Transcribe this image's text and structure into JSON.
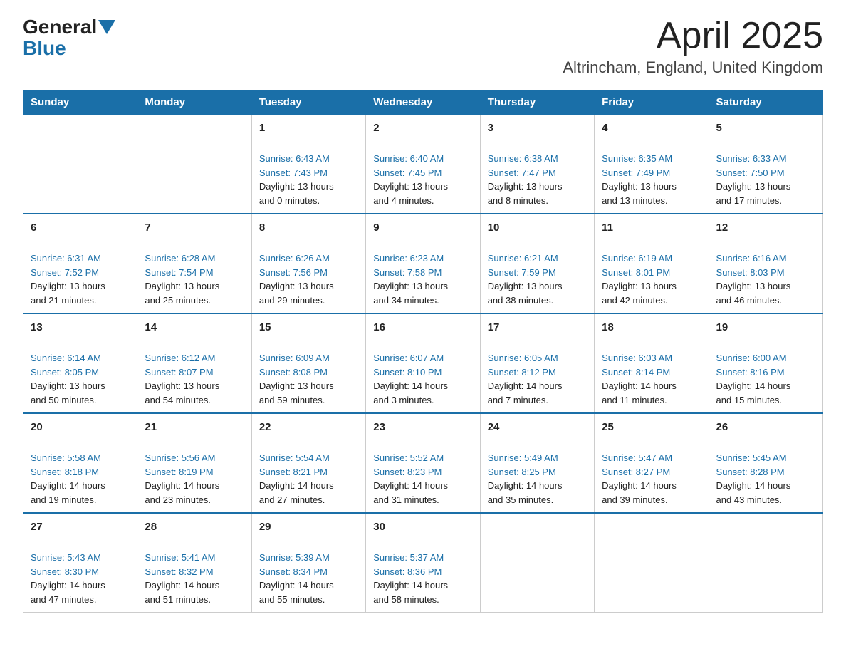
{
  "header": {
    "logo_general": "General",
    "logo_blue": "Blue",
    "month_title": "April 2025",
    "location": "Altrincham, England, United Kingdom"
  },
  "weekdays": [
    "Sunday",
    "Monday",
    "Tuesday",
    "Wednesday",
    "Thursday",
    "Friday",
    "Saturday"
  ],
  "weeks": [
    [
      {
        "day": "",
        "sunrise": "",
        "sunset": "",
        "daylight": ""
      },
      {
        "day": "",
        "sunrise": "",
        "sunset": "",
        "daylight": ""
      },
      {
        "day": "1",
        "sunrise": "Sunrise: 6:43 AM",
        "sunset": "Sunset: 7:43 PM",
        "daylight": "Daylight: 13 hours and 0 minutes."
      },
      {
        "day": "2",
        "sunrise": "Sunrise: 6:40 AM",
        "sunset": "Sunset: 7:45 PM",
        "daylight": "Daylight: 13 hours and 4 minutes."
      },
      {
        "day": "3",
        "sunrise": "Sunrise: 6:38 AM",
        "sunset": "Sunset: 7:47 PM",
        "daylight": "Daylight: 13 hours and 8 minutes."
      },
      {
        "day": "4",
        "sunrise": "Sunrise: 6:35 AM",
        "sunset": "Sunset: 7:49 PM",
        "daylight": "Daylight: 13 hours and 13 minutes."
      },
      {
        "day": "5",
        "sunrise": "Sunrise: 6:33 AM",
        "sunset": "Sunset: 7:50 PM",
        "daylight": "Daylight: 13 hours and 17 minutes."
      }
    ],
    [
      {
        "day": "6",
        "sunrise": "Sunrise: 6:31 AM",
        "sunset": "Sunset: 7:52 PM",
        "daylight": "Daylight: 13 hours and 21 minutes."
      },
      {
        "day": "7",
        "sunrise": "Sunrise: 6:28 AM",
        "sunset": "Sunset: 7:54 PM",
        "daylight": "Daylight: 13 hours and 25 minutes."
      },
      {
        "day": "8",
        "sunrise": "Sunrise: 6:26 AM",
        "sunset": "Sunset: 7:56 PM",
        "daylight": "Daylight: 13 hours and 29 minutes."
      },
      {
        "day": "9",
        "sunrise": "Sunrise: 6:23 AM",
        "sunset": "Sunset: 7:58 PM",
        "daylight": "Daylight: 13 hours and 34 minutes."
      },
      {
        "day": "10",
        "sunrise": "Sunrise: 6:21 AM",
        "sunset": "Sunset: 7:59 PM",
        "daylight": "Daylight: 13 hours and 38 minutes."
      },
      {
        "day": "11",
        "sunrise": "Sunrise: 6:19 AM",
        "sunset": "Sunset: 8:01 PM",
        "daylight": "Daylight: 13 hours and 42 minutes."
      },
      {
        "day": "12",
        "sunrise": "Sunrise: 6:16 AM",
        "sunset": "Sunset: 8:03 PM",
        "daylight": "Daylight: 13 hours and 46 minutes."
      }
    ],
    [
      {
        "day": "13",
        "sunrise": "Sunrise: 6:14 AM",
        "sunset": "Sunset: 8:05 PM",
        "daylight": "Daylight: 13 hours and 50 minutes."
      },
      {
        "day": "14",
        "sunrise": "Sunrise: 6:12 AM",
        "sunset": "Sunset: 8:07 PM",
        "daylight": "Daylight: 13 hours and 54 minutes."
      },
      {
        "day": "15",
        "sunrise": "Sunrise: 6:09 AM",
        "sunset": "Sunset: 8:08 PM",
        "daylight": "Daylight: 13 hours and 59 minutes."
      },
      {
        "day": "16",
        "sunrise": "Sunrise: 6:07 AM",
        "sunset": "Sunset: 8:10 PM",
        "daylight": "Daylight: 14 hours and 3 minutes."
      },
      {
        "day": "17",
        "sunrise": "Sunrise: 6:05 AM",
        "sunset": "Sunset: 8:12 PM",
        "daylight": "Daylight: 14 hours and 7 minutes."
      },
      {
        "day": "18",
        "sunrise": "Sunrise: 6:03 AM",
        "sunset": "Sunset: 8:14 PM",
        "daylight": "Daylight: 14 hours and 11 minutes."
      },
      {
        "day": "19",
        "sunrise": "Sunrise: 6:00 AM",
        "sunset": "Sunset: 8:16 PM",
        "daylight": "Daylight: 14 hours and 15 minutes."
      }
    ],
    [
      {
        "day": "20",
        "sunrise": "Sunrise: 5:58 AM",
        "sunset": "Sunset: 8:18 PM",
        "daylight": "Daylight: 14 hours and 19 minutes."
      },
      {
        "day": "21",
        "sunrise": "Sunrise: 5:56 AM",
        "sunset": "Sunset: 8:19 PM",
        "daylight": "Daylight: 14 hours and 23 minutes."
      },
      {
        "day": "22",
        "sunrise": "Sunrise: 5:54 AM",
        "sunset": "Sunset: 8:21 PM",
        "daylight": "Daylight: 14 hours and 27 minutes."
      },
      {
        "day": "23",
        "sunrise": "Sunrise: 5:52 AM",
        "sunset": "Sunset: 8:23 PM",
        "daylight": "Daylight: 14 hours and 31 minutes."
      },
      {
        "day": "24",
        "sunrise": "Sunrise: 5:49 AM",
        "sunset": "Sunset: 8:25 PM",
        "daylight": "Daylight: 14 hours and 35 minutes."
      },
      {
        "day": "25",
        "sunrise": "Sunrise: 5:47 AM",
        "sunset": "Sunset: 8:27 PM",
        "daylight": "Daylight: 14 hours and 39 minutes."
      },
      {
        "day": "26",
        "sunrise": "Sunrise: 5:45 AM",
        "sunset": "Sunset: 8:28 PM",
        "daylight": "Daylight: 14 hours and 43 minutes."
      }
    ],
    [
      {
        "day": "27",
        "sunrise": "Sunrise: 5:43 AM",
        "sunset": "Sunset: 8:30 PM",
        "daylight": "Daylight: 14 hours and 47 minutes."
      },
      {
        "day": "28",
        "sunrise": "Sunrise: 5:41 AM",
        "sunset": "Sunset: 8:32 PM",
        "daylight": "Daylight: 14 hours and 51 minutes."
      },
      {
        "day": "29",
        "sunrise": "Sunrise: 5:39 AM",
        "sunset": "Sunset: 8:34 PM",
        "daylight": "Daylight: 14 hours and 55 minutes."
      },
      {
        "day": "30",
        "sunrise": "Sunrise: 5:37 AM",
        "sunset": "Sunset: 8:36 PM",
        "daylight": "Daylight: 14 hours and 58 minutes."
      },
      {
        "day": "",
        "sunrise": "",
        "sunset": "",
        "daylight": ""
      },
      {
        "day": "",
        "sunrise": "",
        "sunset": "",
        "daylight": ""
      },
      {
        "day": "",
        "sunrise": "",
        "sunset": "",
        "daylight": ""
      }
    ]
  ]
}
